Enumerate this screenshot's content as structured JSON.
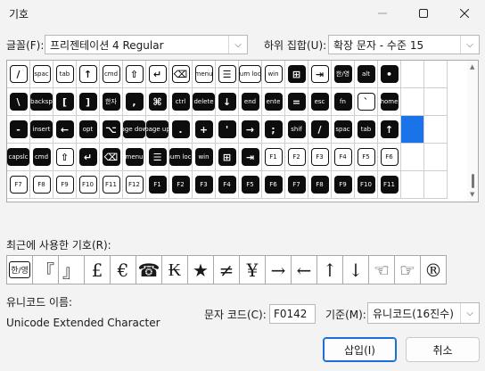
{
  "window": {
    "title": "기호"
  },
  "font": {
    "label": "글꼴(F):",
    "value": "프리젠테이션 4 Regular"
  },
  "subset": {
    "label": "하위 집합(U):",
    "value": "확장 문자 - 수준 15"
  },
  "grid": {
    "selected_index": 55,
    "rows": [
      [
        {
          "t": "/",
          "s": "o"
        },
        {
          "t": "spac",
          "s": "o"
        },
        {
          "t": "tab",
          "s": "o"
        },
        {
          "t": "↑",
          "s": "o"
        },
        {
          "t": "cmd",
          "s": "o"
        },
        {
          "t": "⇧",
          "s": "o"
        },
        {
          "t": "↵",
          "s": "o"
        },
        {
          "t": "⌫",
          "s": "o"
        },
        {
          "t": "menu",
          "s": "o"
        },
        {
          "t": "☰",
          "s": "o"
        },
        {
          "t": "num lock",
          "s": "o"
        },
        {
          "t": "win",
          "s": "o"
        },
        {
          "t": "⊞",
          "s": "f"
        },
        {
          "t": "⇥",
          "s": "o"
        },
        {
          "t": "한/영",
          "s": "f"
        },
        {
          "t": "alt",
          "s": "f"
        },
        {
          "t": "•",
          "s": "f"
        },
        {
          "t": "",
          "s": "o"
        },
        {
          "t": "",
          "s": "o"
        }
      ],
      [
        {
          "t": "\\",
          "s": "f"
        },
        {
          "t": "backsp",
          "s": "f"
        },
        {
          "t": "[",
          "s": "f"
        },
        {
          "t": "]",
          "s": "f"
        },
        {
          "t": "한자",
          "s": "f"
        },
        {
          "t": ",",
          "s": "f"
        },
        {
          "t": "⌘",
          "s": "f"
        },
        {
          "t": "ctrl",
          "s": "f"
        },
        {
          "t": "delete",
          "s": "f"
        },
        {
          "t": "↓",
          "s": "f"
        },
        {
          "t": "end",
          "s": "f"
        },
        {
          "t": "ente",
          "s": "f"
        },
        {
          "t": "=",
          "s": "f"
        },
        {
          "t": "esc",
          "s": "f"
        },
        {
          "t": "fn",
          "s": "f"
        },
        {
          "t": "`",
          "s": "o"
        },
        {
          "t": "home",
          "s": "f"
        },
        {
          "t": "",
          "s": "o"
        },
        {
          "t": "",
          "s": "o"
        }
      ],
      [
        {
          "t": "-",
          "s": "f"
        },
        {
          "t": "insert",
          "s": "f"
        },
        {
          "t": "←",
          "s": "f"
        },
        {
          "t": "opt",
          "s": "f"
        },
        {
          "t": "⌥",
          "s": "f"
        },
        {
          "t": "page down",
          "s": "f"
        },
        {
          "t": "page up",
          "s": "f"
        },
        {
          "t": ".",
          "s": "f"
        },
        {
          "t": "+",
          "s": "f"
        },
        {
          "t": "'",
          "s": "f"
        },
        {
          "t": "→",
          "s": "f"
        },
        {
          "t": ";",
          "s": "f"
        },
        {
          "t": "shif",
          "s": "f"
        },
        {
          "t": "/",
          "s": "f"
        },
        {
          "t": "spac",
          "s": "f"
        },
        {
          "t": "tab",
          "s": "f"
        },
        {
          "t": "↑",
          "s": "f"
        },
        {
          "t": "",
          "s": "o"
        },
        {
          "t": "",
          "s": "o"
        }
      ],
      [
        {
          "t": "capslc",
          "s": "f"
        },
        {
          "t": "cmd",
          "s": "f"
        },
        {
          "t": "⇧",
          "s": "o"
        },
        {
          "t": "↵",
          "s": "f"
        },
        {
          "t": "⌫",
          "s": "f"
        },
        {
          "t": "menu",
          "s": "f"
        },
        {
          "t": "☰",
          "s": "f"
        },
        {
          "t": "num lock",
          "s": "f"
        },
        {
          "t": "win",
          "s": "f"
        },
        {
          "t": "⊞",
          "s": "f"
        },
        {
          "t": "⇥",
          "s": "f"
        },
        {
          "t": "F1",
          "s": "o"
        },
        {
          "t": "F2",
          "s": "o"
        },
        {
          "t": "F3",
          "s": "o"
        },
        {
          "t": "F4",
          "s": "o"
        },
        {
          "t": "F5",
          "s": "o"
        },
        {
          "t": "F6",
          "s": "o"
        },
        {
          "t": "",
          "s": "o"
        },
        {
          "t": "",
          "s": "o"
        }
      ],
      [
        {
          "t": "F7",
          "s": "o"
        },
        {
          "t": "F8",
          "s": "o"
        },
        {
          "t": "F9",
          "s": "o"
        },
        {
          "t": "F10",
          "s": "o"
        },
        {
          "t": "F11",
          "s": "o"
        },
        {
          "t": "F12",
          "s": "o"
        },
        {
          "t": "F1",
          "s": "f"
        },
        {
          "t": "F2",
          "s": "f"
        },
        {
          "t": "F3",
          "s": "f"
        },
        {
          "t": "F4",
          "s": "f"
        },
        {
          "t": "F5",
          "s": "f"
        },
        {
          "t": "F6",
          "s": "f"
        },
        {
          "t": "F7",
          "s": "f"
        },
        {
          "t": "F8",
          "s": "f"
        },
        {
          "t": "F9",
          "s": "f"
        },
        {
          "t": "F10",
          "s": "f"
        },
        {
          "t": "F11",
          "s": "f"
        },
        {
          "t": "",
          "s": "o"
        },
        {
          "t": "",
          "s": "o"
        }
      ]
    ]
  },
  "recent": {
    "label": "최근에 사용한 기호(R):",
    "symbols": [
      "한/영",
      "『",
      "』",
      "£",
      "€",
      "☎",
      "₭",
      "★",
      "≠",
      "¥",
      "→",
      "←",
      "↑",
      "↓",
      "☜",
      "☞",
      "®"
    ]
  },
  "unicode": {
    "name_label": "유니코드 이름:",
    "name_value": "Unicode Extended Character"
  },
  "charcode": {
    "label": "문자 코드(C):",
    "value": "F0142"
  },
  "base": {
    "label": "기준(M):",
    "value": "유니코드(16진수)"
  },
  "buttons": {
    "insert": "삽입(I)",
    "cancel": "취소"
  },
  "icons": {
    "minimize": "minimize-icon",
    "maximize": "maximize-icon",
    "close": "close-icon"
  }
}
